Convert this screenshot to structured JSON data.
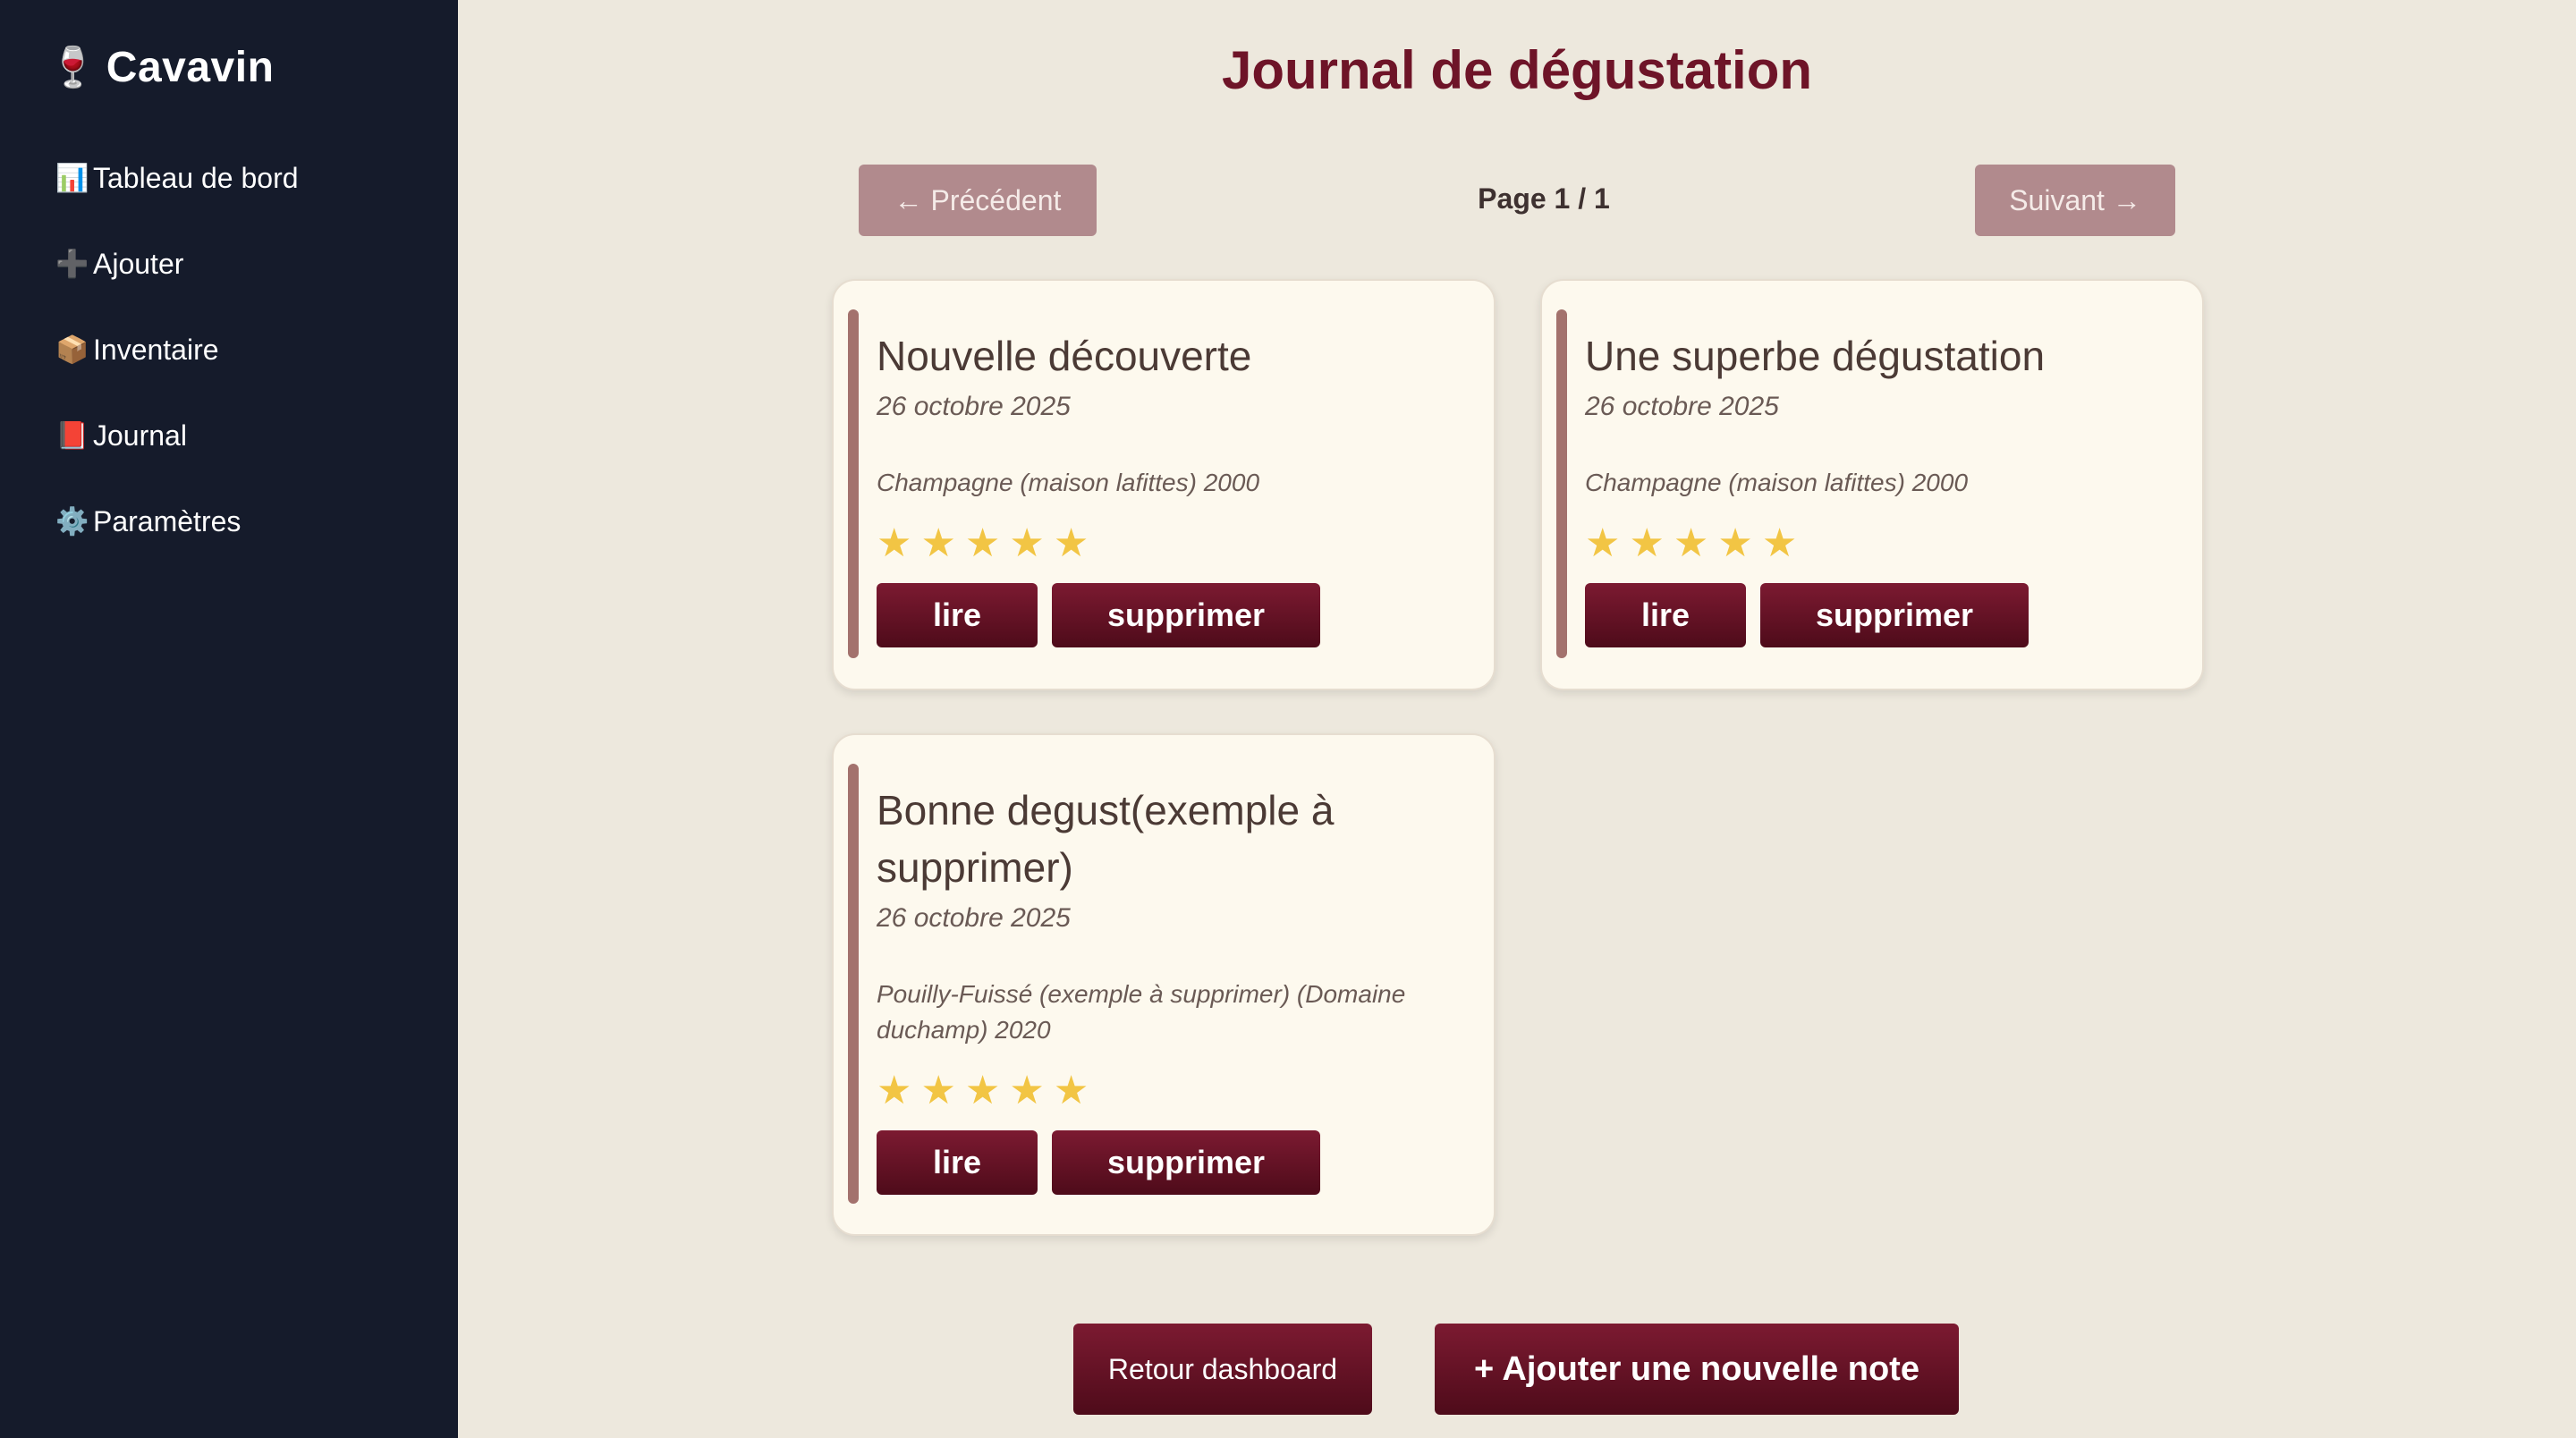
{
  "app": {
    "icon": "🍷",
    "name": "Cavavin"
  },
  "sidebar": {
    "items": [
      {
        "icon": "📊",
        "label": "Tableau de bord"
      },
      {
        "icon": "➕",
        "label": "Ajouter"
      },
      {
        "icon": "📦",
        "label": "Inventaire"
      },
      {
        "icon": "📕",
        "label": "Journal"
      },
      {
        "icon": "⚙️",
        "label": "Paramètres"
      }
    ]
  },
  "main": {
    "title": "Journal de dégustation",
    "pager": {
      "prev_label": "← Précédent",
      "page_label": "Page 1 / 1",
      "next_label": "Suivant →"
    },
    "notes": [
      {
        "title": "Nouvelle découverte",
        "date": "26 octobre 2025",
        "wine": "Champagne (maison lafittes) 2000",
        "rating": 5,
        "read_label": "lire",
        "delete_label": "supprimer"
      },
      {
        "title": "Une superbe dégustation",
        "date": "26 octobre 2025",
        "wine": "Champagne (maison lafittes) 2000",
        "rating": 5,
        "read_label": "lire",
        "delete_label": "supprimer"
      },
      {
        "title": "Bonne degust(exemple à supprimer)",
        "date": "26 octobre 2025",
        "wine": "Pouilly-Fuissé (exemple à supprimer) (Domaine duchamp) 2020",
        "rating": 5,
        "read_label": "lire",
        "delete_label": "supprimer"
      }
    ],
    "footer": {
      "back_label": "Retour dashboard",
      "add_label": "+ Ajouter une nouvelle note"
    }
  },
  "colors": {
    "sidebar_bg": "#151b2b",
    "page_bg": "#ede8dd",
    "accent": "#6e1428",
    "star": "#f2c544"
  }
}
